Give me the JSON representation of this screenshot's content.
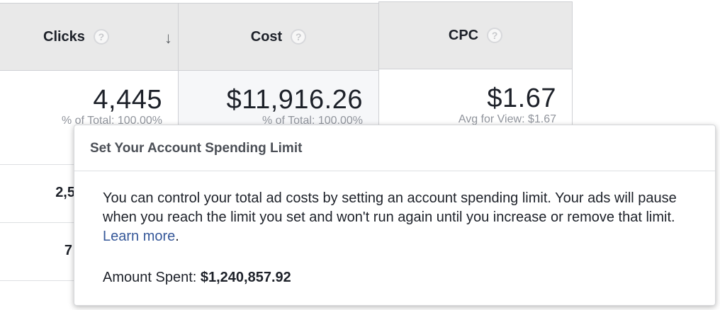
{
  "columns": [
    {
      "label": "Clicks",
      "value": "4,445",
      "sub": "% of Total: 100.00%",
      "sorted": true
    },
    {
      "label": "Cost",
      "value": "$11,916.26",
      "sub": "% of Total: 100.00%",
      "sorted": false
    },
    {
      "label": "CPC",
      "value": "$1.67",
      "sub": "Avg for View: $1.67",
      "sorted": false
    }
  ],
  "rows": [
    "2,5",
    "7"
  ],
  "help_glyph": "?",
  "sort_glyph": "↓",
  "popup": {
    "title": "Set Your Account Spending Limit",
    "body": "You can control your total ad costs by setting an account spending limit. Your ads will pause when you reach the limit you set and won't run again until you increase or remove that limit.",
    "link": "Learn more",
    "link_suffix": ".",
    "amount_label": "Amount Spent:",
    "amount_value": "$1,240,857.92"
  },
  "colors": {
    "link": "#365899",
    "header_bg": "#e9e9e9"
  }
}
